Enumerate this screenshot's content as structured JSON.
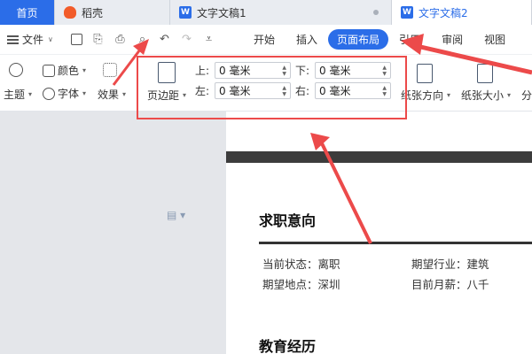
{
  "tabs": {
    "home": "首页",
    "daoke": "稻壳",
    "doc1": "文字文稿1",
    "doc2": "文字文稿2"
  },
  "menu": {
    "file": "文件",
    "tabs": [
      "开始",
      "插入",
      "页面布局",
      "引用",
      "审阅",
      "视图"
    ],
    "active_tab": "页面布局"
  },
  "ribbon": {
    "theme": "主题",
    "color": "颜色",
    "font": "字体",
    "effect": "效果",
    "margins": "页边距",
    "top_label": "上:",
    "top_value": "0 毫米",
    "bottom_label": "下:",
    "bottom_value": "0 毫米",
    "left_label": "左:",
    "left_value": "0 毫米",
    "right_label": "右:",
    "right_value": "0 毫米",
    "orientation": "纸张方向",
    "size": "纸张大小",
    "more": "分"
  },
  "document": {
    "section1_title": "求职意向",
    "status_label": "当前状态：离职",
    "industry_label": "期望行业：建筑",
    "location_label": "期望地点：深圳",
    "salary_label": "目前月薪：八千",
    "section2_title": "教育经历"
  },
  "colors": {
    "accent": "#2b6de8",
    "annotation": "#ec4a4a"
  }
}
